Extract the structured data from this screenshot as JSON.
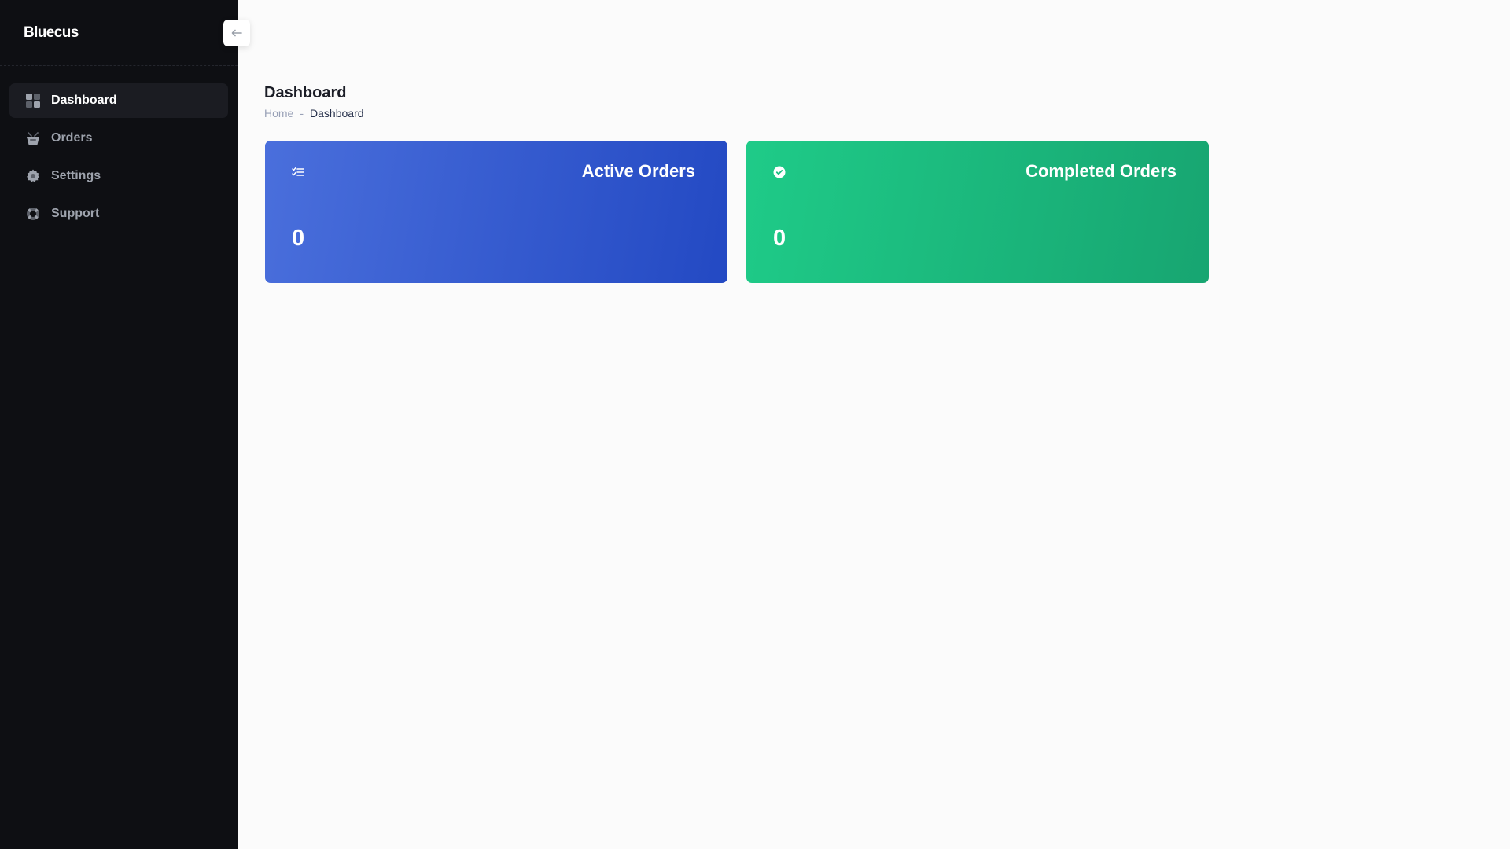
{
  "brand": {
    "name": "Bluecus"
  },
  "sidebar": {
    "collapse_icon": "arrow-left-icon",
    "items": [
      {
        "label": "Dashboard",
        "icon": "grid-icon",
        "active": true
      },
      {
        "label": "Orders",
        "icon": "basket-icon",
        "active": false
      },
      {
        "label": "Settings",
        "icon": "gear-icon",
        "active": false
      },
      {
        "label": "Support",
        "icon": "lifebuoy-icon",
        "active": false
      }
    ]
  },
  "page": {
    "title": "Dashboard",
    "breadcrumb": {
      "home": "Home",
      "separator": "-",
      "current": "Dashboard"
    }
  },
  "cards": [
    {
      "title": "Active Orders",
      "value": "0",
      "icon": "checklist-icon",
      "color": "#2f55cf"
    },
    {
      "title": "Completed Orders",
      "value": "0",
      "icon": "check-circle-icon",
      "color": "#1bbd80"
    }
  ],
  "colors": {
    "sidebar_bg": "#0e0f13",
    "main_bg": "#fbfbfb",
    "active_item_bg": "#1b1c22"
  }
}
